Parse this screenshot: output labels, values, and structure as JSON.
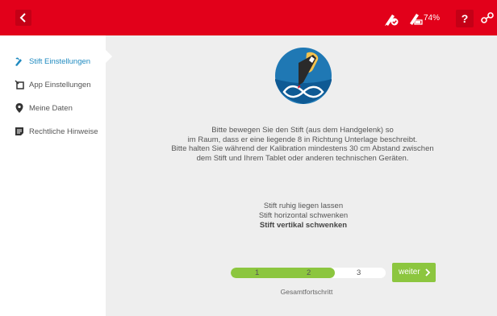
{
  "topbar": {
    "battery_percent": "74%",
    "help_label": "?"
  },
  "sidebar": {
    "items": [
      {
        "label": "Stift Einstellungen",
        "icon": "pen-settings-icon",
        "active": true
      },
      {
        "label": "App Einstellungen",
        "icon": "app-settings-icon",
        "active": false
      },
      {
        "label": "Meine Daten",
        "icon": "location-pin-icon",
        "active": false
      },
      {
        "label": "Rechtliche Hinweise",
        "icon": "document-icon",
        "active": false
      }
    ]
  },
  "main": {
    "instructions": [
      "Bitte bewegen Sie den Stift (aus dem Handgelenk) so",
      "im Raum, dass er eine liegende 8 in Richtung Unterlage beschreibt.",
      "Bitte halten Sie während der Kalibration mindestens 30 cm Abstand zwischen",
      "dem Stift und Ihrem Tablet oder anderen technischen Geräten."
    ],
    "steps": [
      "Stift ruhig liegen lassen",
      "Stift horizontal schwenken",
      "Stift vertikal schwenken"
    ],
    "progress": {
      "step_labels": [
        "1",
        "2",
        "3"
      ],
      "completed_fraction": 0.67,
      "caption": "Gesamtfortschritt"
    },
    "next_label": "weiter"
  },
  "colors": {
    "accent_red": "#e2001a",
    "sidebar_active": "#1f8ac0",
    "progress_green": "#8cc63f"
  }
}
